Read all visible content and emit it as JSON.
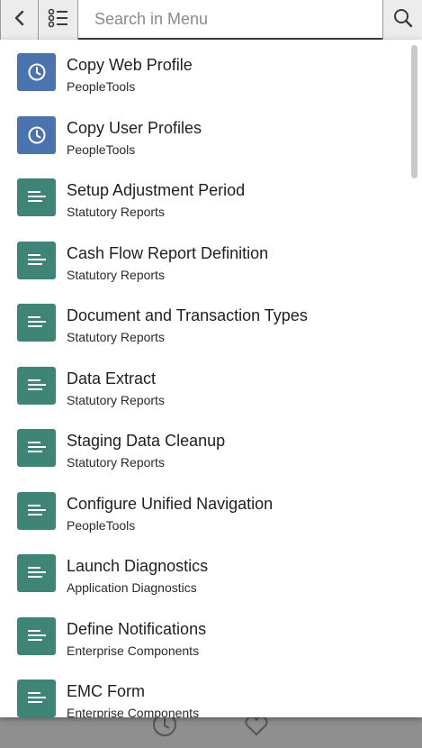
{
  "search": {
    "placeholder": "Search in Menu",
    "value": ""
  },
  "colors": {
    "clock_tile": "#4a73b0",
    "doc_tile": "#3e8577"
  },
  "menu": {
    "items": [
      {
        "title": "Copy Web Profile",
        "subtitle": "PeopleTools",
        "icon": "clock-icon"
      },
      {
        "title": "Copy User Profiles",
        "subtitle": "PeopleTools",
        "icon": "clock-icon"
      },
      {
        "title": "Setup Adjustment Period",
        "subtitle": "Statutory Reports",
        "icon": "lines-icon"
      },
      {
        "title": "Cash Flow Report Definition",
        "subtitle": "Statutory Reports",
        "icon": "lines-icon"
      },
      {
        "title": "Document and Transaction Types",
        "subtitle": "Statutory Reports",
        "icon": "lines-icon"
      },
      {
        "title": "Data Extract",
        "subtitle": "Statutory Reports",
        "icon": "lines-icon"
      },
      {
        "title": "Staging Data Cleanup",
        "subtitle": "Statutory Reports",
        "icon": "lines-icon"
      },
      {
        "title": "Configure Unified Navigation",
        "subtitle": "PeopleTools",
        "icon": "lines-icon"
      },
      {
        "title": "Launch Diagnostics",
        "subtitle": "Application Diagnostics",
        "icon": "lines-icon"
      },
      {
        "title": "Define Notifications",
        "subtitle": "Enterprise Components",
        "icon": "lines-icon"
      },
      {
        "title": "EMC Form",
        "subtitle": "Enterprise Components",
        "icon": "lines-icon"
      }
    ]
  }
}
